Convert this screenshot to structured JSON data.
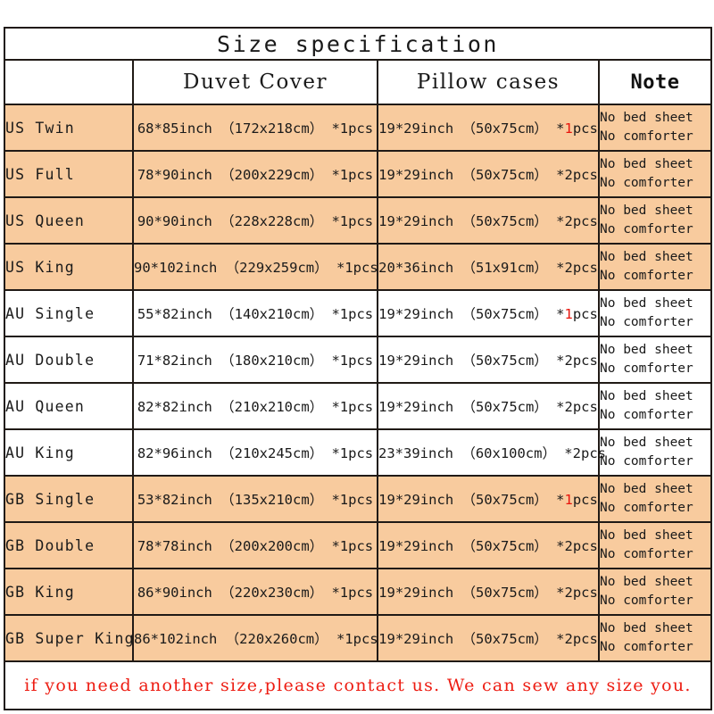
{
  "title": "Size specification",
  "colors": {
    "shade_row": "#f8cb9e",
    "plain_row": "#ffffff",
    "border": "#201a16",
    "accent_red": "#e8140c",
    "footer_red": "#ed1c12"
  },
  "header": {
    "size_column": "",
    "duvet_cover": "Duvet Cover",
    "pillow_cases": "Pillow cases",
    "note": "Note"
  },
  "note_lines": {
    "line1": "No bed sheet",
    "line2": "No comforter"
  },
  "rows": [
    {
      "size": "US Twin",
      "duvet": "68*85inch （172x218cm） *1pcs",
      "pillow_main": "19*29inch （50x75cm） *",
      "pillow_qty": "1",
      "pillow_qty_red": true,
      "pillow_tail": "pcs",
      "shaded": true
    },
    {
      "size": "US Full",
      "duvet": "78*90inch （200x229cm） *1pcs",
      "pillow_main": "19*29inch （50x75cm） *",
      "pillow_qty": "2",
      "pillow_qty_red": false,
      "pillow_tail": "pcs",
      "shaded": true
    },
    {
      "size": "US Queen",
      "duvet": "90*90inch （228x228cm） *1pcs",
      "pillow_main": "19*29inch （50x75cm） *",
      "pillow_qty": "2",
      "pillow_qty_red": false,
      "pillow_tail": "pcs",
      "shaded": true
    },
    {
      "size": "US King",
      "duvet": "90*102inch （229x259cm） *1pcs",
      "pillow_main": "20*36inch （51x91cm） *",
      "pillow_qty": "2",
      "pillow_qty_red": false,
      "pillow_tail": "pcs",
      "shaded": true
    },
    {
      "size": "AU Single",
      "duvet": "55*82inch （140x210cm） *1pcs",
      "pillow_main": "19*29inch （50x75cm） *",
      "pillow_qty": "1",
      "pillow_qty_red": true,
      "pillow_tail": "pcs",
      "shaded": false
    },
    {
      "size": "AU Double",
      "duvet": "71*82inch （180x210cm） *1pcs",
      "pillow_main": "19*29inch （50x75cm） *",
      "pillow_qty": "2",
      "pillow_qty_red": false,
      "pillow_tail": "pcs",
      "shaded": false
    },
    {
      "size": "AU Queen",
      "duvet": "82*82inch （210x210cm） *1pcs",
      "pillow_main": "19*29inch （50x75cm） *",
      "pillow_qty": "2",
      "pillow_qty_red": false,
      "pillow_tail": "pcs",
      "shaded": false
    },
    {
      "size": "AU King",
      "duvet": "82*96inch （210x245cm） *1pcs",
      "pillow_main": "23*39inch （60x100cm） *",
      "pillow_qty": "2",
      "pillow_qty_red": false,
      "pillow_tail": "pcs",
      "shaded": false
    },
    {
      "size": "GB Single",
      "duvet": "53*82inch （135x210cm） *1pcs",
      "pillow_main": "19*29inch （50x75cm） *",
      "pillow_qty": "1",
      "pillow_qty_red": true,
      "pillow_tail": "pcs",
      "shaded": true
    },
    {
      "size": "GB Double",
      "duvet": "78*78inch （200x200cm） *1pcs",
      "pillow_main": "19*29inch （50x75cm） *",
      "pillow_qty": "2",
      "pillow_qty_red": false,
      "pillow_tail": "pcs",
      "shaded": true
    },
    {
      "size": "GB King",
      "duvet": "86*90inch （220x230cm） *1pcs",
      "pillow_main": "19*29inch （50x75cm） *",
      "pillow_qty": "2",
      "pillow_qty_red": false,
      "pillow_tail": "pcs",
      "shaded": true
    },
    {
      "size": "GB Super King",
      "duvet": "86*102inch （220x260cm） *1pcs",
      "pillow_main": "19*29inch （50x75cm） *",
      "pillow_qty": "2",
      "pillow_qty_red": false,
      "pillow_tail": "pcs",
      "shaded": true
    }
  ],
  "footer": {
    "message": "if you need another size,please contact us. We can sew any size you."
  }
}
